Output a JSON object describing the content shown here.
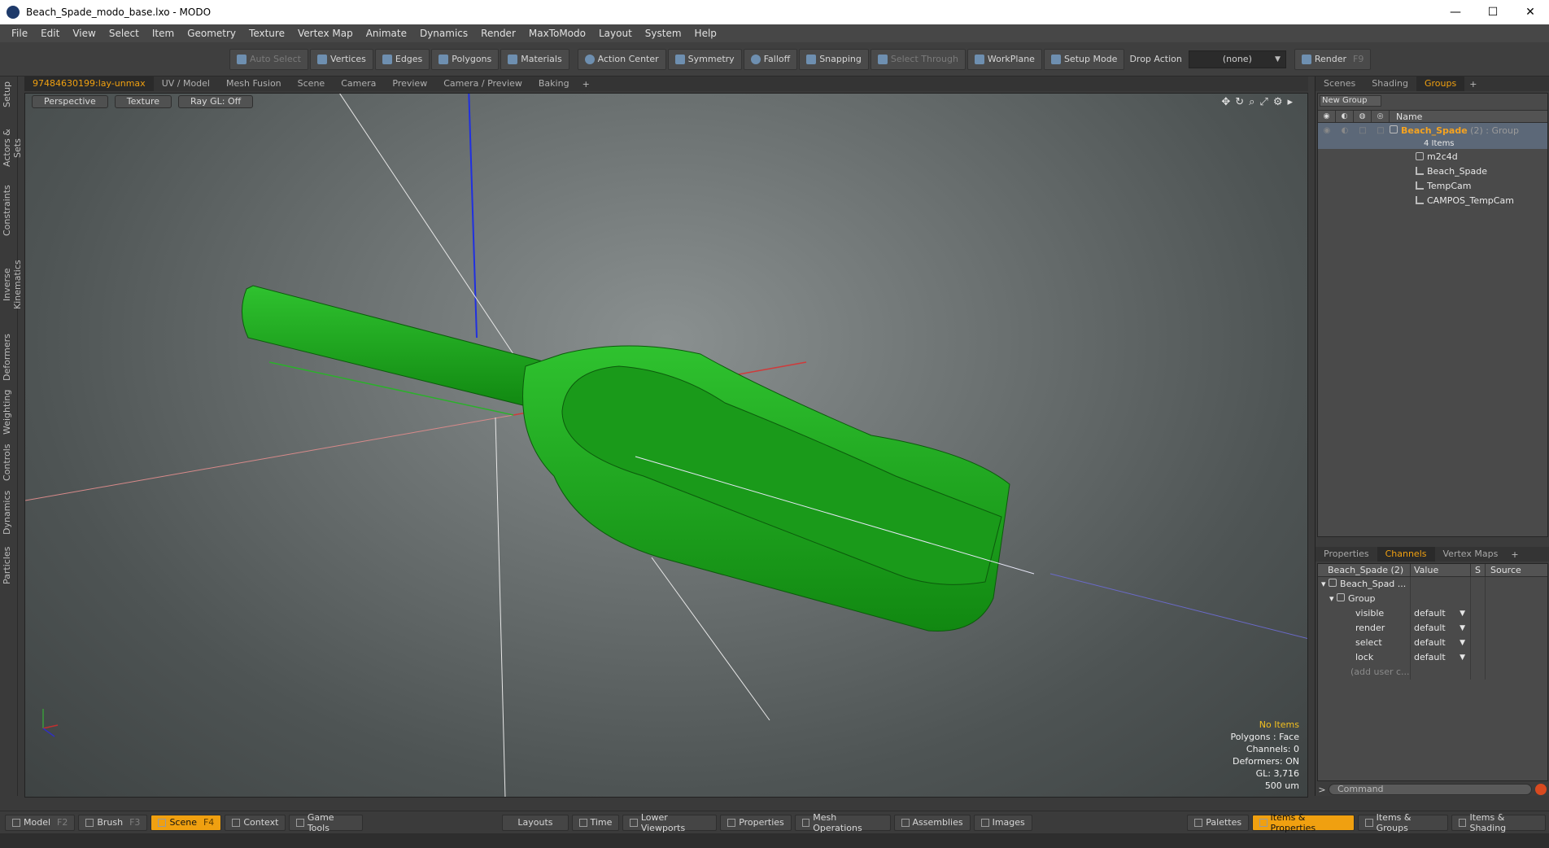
{
  "window": {
    "title": "Beach_Spade_modo_base.lxo - MODO",
    "minimize": "—",
    "maximize": "☐",
    "close": "✕"
  },
  "menu": [
    "File",
    "Edit",
    "View",
    "Select",
    "Item",
    "Geometry",
    "Texture",
    "Vertex Map",
    "Animate",
    "Dynamics",
    "Render",
    "MaxToModo",
    "Layout",
    "System",
    "Help"
  ],
  "toolbar": {
    "auto_select": "Auto Select",
    "vertices": "Vertices",
    "edges": "Edges",
    "polygons": "Polygons",
    "materials": "Materials",
    "action_center": "Action Center",
    "symmetry": "Symmetry",
    "falloff": "Falloff",
    "snapping": "Snapping",
    "select_through": "Select Through",
    "workplane": "WorkPlane",
    "setup_mode": "Setup Mode",
    "drop_action": "Drop Action",
    "drop_value": "(none)",
    "render": "Render",
    "render_key": "F9"
  },
  "left_rail": [
    "Setup",
    "Actors & Sets",
    "Constraints",
    "Inverse Kinematics",
    "Deformers",
    "Weighting",
    "Controls",
    "Dynamics",
    "Particles"
  ],
  "viewport_tabs": [
    "97484630199:lay-unmax",
    "UV / Model",
    "Mesh Fusion",
    "Scene",
    "Camera",
    "Preview",
    "Camera / Preview",
    "Baking"
  ],
  "viewport_tab_plus": "+",
  "viewport_header": {
    "view": "Perspective",
    "shading": "Texture",
    "raygl": "Ray GL: Off"
  },
  "viewport_info": {
    "selection": "No Items",
    "polygons": "Polygons : Face",
    "channels": "Channels: 0",
    "deformers": "Deformers: ON",
    "gl": "GL: 3,716",
    "scale": "500 um"
  },
  "right_tabs": [
    "Scenes",
    "Shading",
    "Groups"
  ],
  "right_tab_plus": "+",
  "groups": {
    "new_group": "New Group",
    "header_name": "Name",
    "root_name": "Beach_Spade",
    "root_suffix": " (2) : Group",
    "root_count": "4 Items",
    "items": [
      "m2c4d",
      "Beach_Spade",
      "TempCam",
      "CAMPOS_TempCam"
    ]
  },
  "channel_tabs": [
    "Properties",
    "Channels",
    "Vertex Maps"
  ],
  "channel_tab_plus": "+",
  "channels": {
    "col_item": "Beach_Spade (2)",
    "col_value": "Value",
    "col_s": "S",
    "col_source": "Source",
    "root": "Beach_Spad ...",
    "group": "Group",
    "rows": [
      {
        "name": "visible",
        "value": "default"
      },
      {
        "name": "render",
        "value": "default"
      },
      {
        "name": "select",
        "value": "default"
      },
      {
        "name": "lock",
        "value": "default"
      }
    ],
    "add_user": "(add user c..."
  },
  "command": {
    "prompt": ">",
    "placeholder": "Command"
  },
  "bottom": {
    "model": "Model",
    "model_key": "F2",
    "brush": "Brush",
    "brush_key": "F3",
    "scene": "Scene",
    "scene_key": "F4",
    "context": "Context",
    "game_tools": "Game Tools",
    "layouts": "Layouts",
    "time": "Time",
    "lower_viewports": "Lower Viewports",
    "properties": "Properties",
    "mesh_operations": "Mesh Operations",
    "assemblies": "Assemblies",
    "images": "Images",
    "palettes": "Palettes",
    "items_properties": "Items & Properties",
    "items_groups": "Items & Groups",
    "items_shading": "Items & Shading"
  },
  "colors": {
    "accent": "#f0a010",
    "mesh": "#1fa31f",
    "axis_x": "#e04040",
    "axis_y": "#20b020",
    "axis_z": "#2040e0"
  }
}
